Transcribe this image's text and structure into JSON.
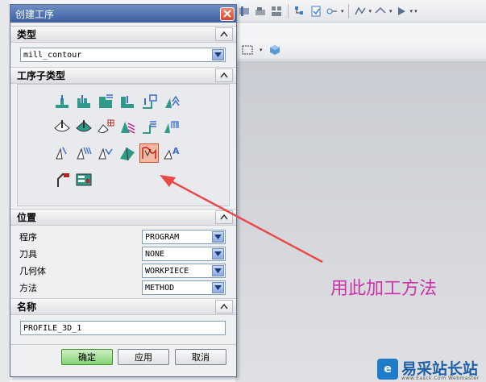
{
  "dialog": {
    "title": "创建工序",
    "sections": {
      "type": {
        "title": "类型",
        "value": "mill_contour"
      },
      "subtype": {
        "title": "工序子类型"
      },
      "location": {
        "title": "位置",
        "fields": [
          {
            "label": "程序",
            "value": "PROGRAM"
          },
          {
            "label": "刀具",
            "value": "NONE"
          },
          {
            "label": "几何体",
            "value": "WORKPIECE"
          },
          {
            "label": "方法",
            "value": "METHOD"
          }
        ]
      },
      "name": {
        "title": "名称",
        "value": "PROFILE_3D_1"
      }
    },
    "buttons": {
      "ok": "确定",
      "apply": "应用",
      "cancel": "取消"
    }
  },
  "annotation": {
    "text": "用此加工方法",
    "color": "#cc33aa"
  },
  "watermark": {
    "logo": "e",
    "text": "易采站长站",
    "url": "www.Easck.Com Webmaster"
  },
  "colors": {
    "title_bar": "#3c5ea0",
    "selected_icon": "#f2b8a0",
    "arrow": "#e84a4a"
  }
}
